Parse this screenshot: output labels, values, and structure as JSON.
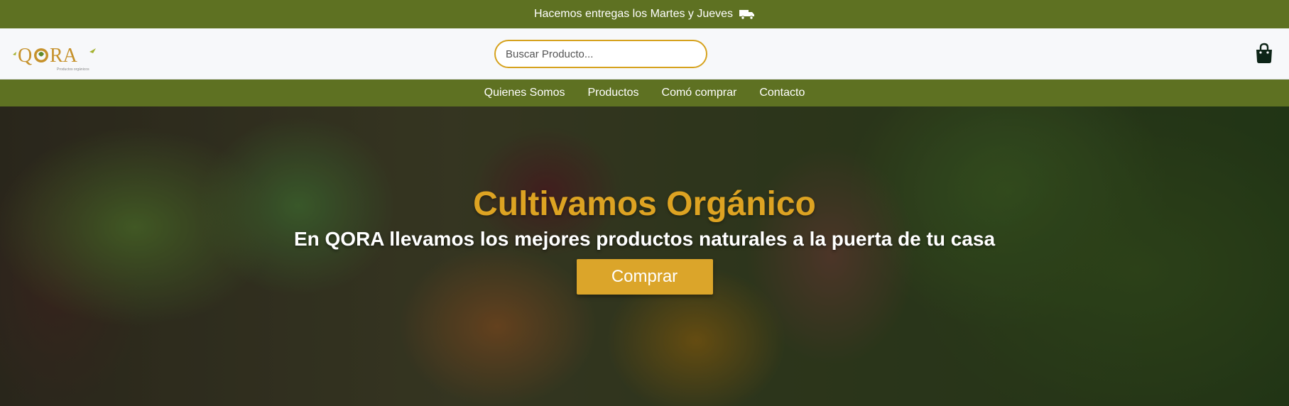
{
  "topbar": {
    "text": "Hacemos entregas los Martes y Jueves",
    "icon": "truck-icon"
  },
  "header": {
    "logo": {
      "text": "QORA",
      "tagline": "Productos orgánicos"
    },
    "search": {
      "placeholder": "Buscar Producto..."
    },
    "cart_icon": "shopping-bag-icon"
  },
  "nav": {
    "items": [
      {
        "label": "Quienes Somos"
      },
      {
        "label": "Productos"
      },
      {
        "label": "Comó comprar"
      },
      {
        "label": "Contacto"
      }
    ]
  },
  "hero": {
    "title": "Cultivamos Orgánico",
    "subtitle": "En QORA llevamos los mejores productos naturales a la puerta de tu casa",
    "button_label": "Comprar"
  },
  "colors": {
    "brand_green": "#5e7122",
    "accent_gold": "#dba52a",
    "search_border": "#d6a21d",
    "title_gold": "#dda322"
  }
}
